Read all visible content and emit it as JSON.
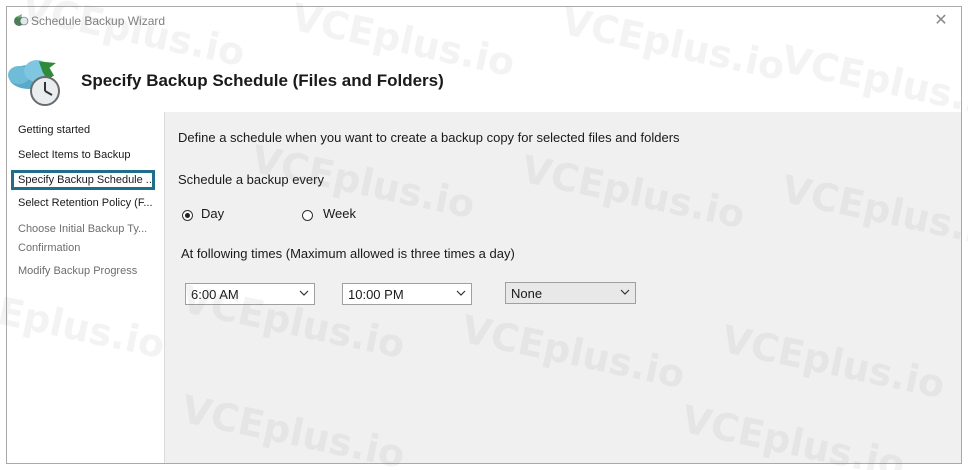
{
  "window": {
    "title": "Schedule Backup Wizard",
    "close_symbol": "✕"
  },
  "header": {
    "title": "Specify Backup Schedule (Files and Folders)"
  },
  "sidebar": {
    "items": [
      {
        "label": "Getting started",
        "state": "normal"
      },
      {
        "label": "Select Items to Backup",
        "state": "normal"
      },
      {
        "label": "Specify Backup Schedule ...",
        "state": "selected"
      },
      {
        "label": "Select Retention Policy (F...",
        "state": "normal"
      },
      {
        "label": "Choose Initial Backup Ty...",
        "state": "disabled"
      },
      {
        "label": "Confirmation",
        "state": "disabled"
      },
      {
        "label": "Modify Backup Progress",
        "state": "disabled"
      }
    ]
  },
  "main": {
    "description": "Define a schedule when you want to create a backup copy for selected files and folders",
    "schedule_label": "Schedule a backup every",
    "frequency": {
      "day_label": "Day",
      "week_label": "Week",
      "selected": "Day"
    },
    "times_label": "At following times (Maximum allowed is three times a day)",
    "times": [
      "6:00 AM",
      "10:00 PM",
      "None"
    ]
  },
  "watermark": {
    "text": "VCEplus.io"
  },
  "colors": {
    "selection_border": "#1f6f8b",
    "content_background": "#f0f0f0"
  }
}
